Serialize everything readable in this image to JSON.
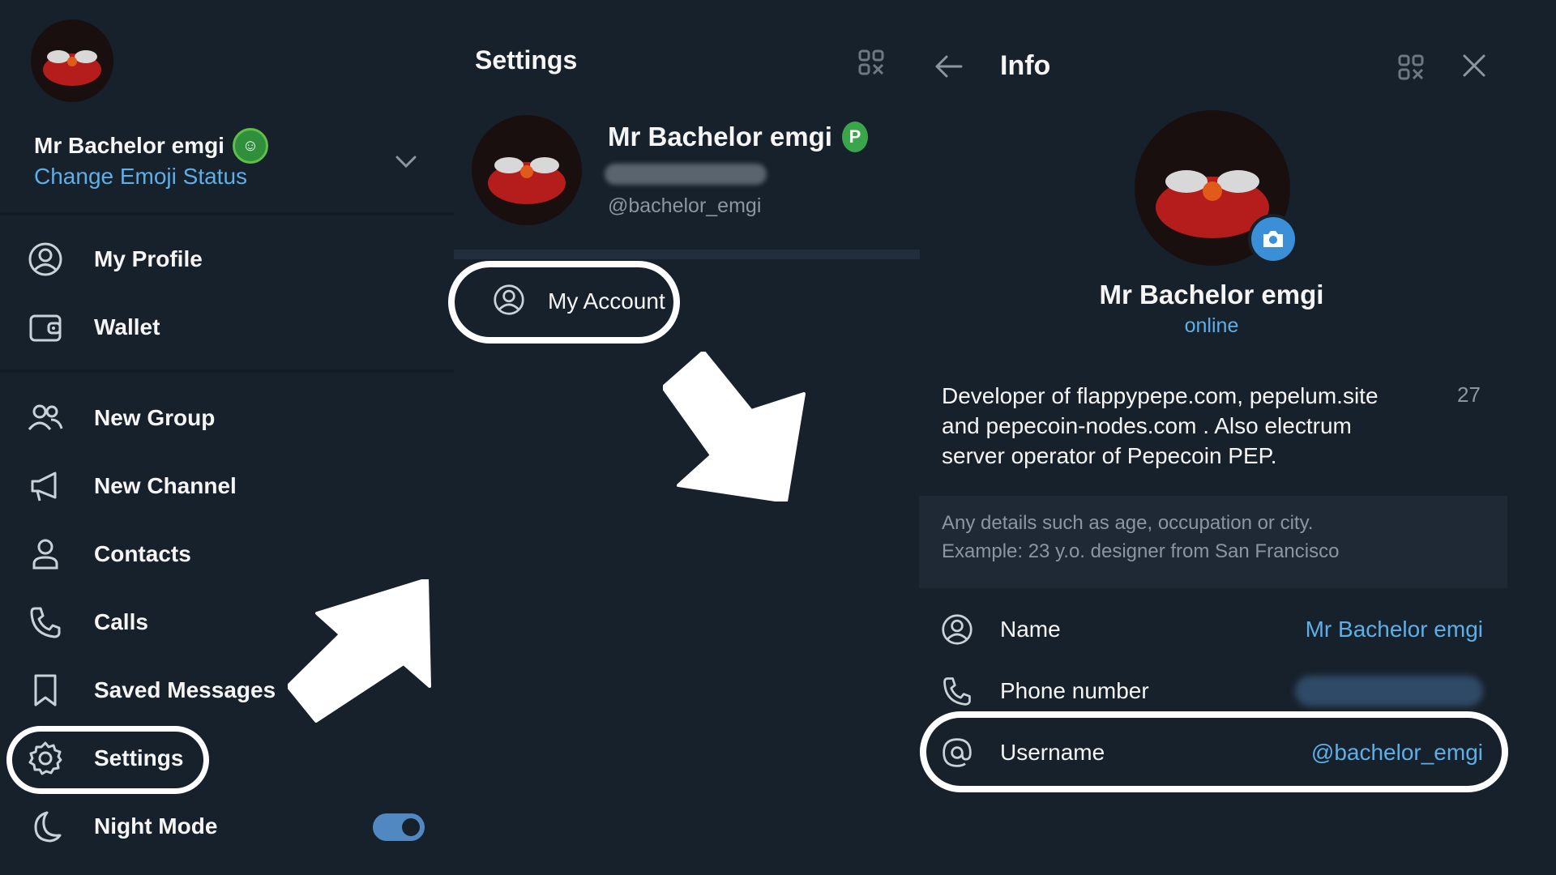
{
  "sidebar": {
    "user_name": "Mr Bachelor emgi",
    "status_link": "Change Emoji Status",
    "menu": [
      {
        "label": "My Profile",
        "icon": "profile-icon"
      },
      {
        "label": "Wallet",
        "icon": "wallet-icon"
      },
      {
        "label": "New Group",
        "icon": "group-icon"
      },
      {
        "label": "New Channel",
        "icon": "megaphone-icon"
      },
      {
        "label": "Contacts",
        "icon": "contact-icon"
      },
      {
        "label": "Calls",
        "icon": "phone-icon"
      },
      {
        "label": "Saved Messages",
        "icon": "bookmark-icon"
      },
      {
        "label": "Settings",
        "icon": "gear-icon"
      },
      {
        "label": "Night Mode",
        "icon": "moon-icon"
      }
    ],
    "night_mode_on": true
  },
  "settings": {
    "title": "Settings",
    "name": "Mr Bachelor emgi",
    "badge": "P",
    "username": "@bachelor_emgi",
    "items": [
      {
        "label": "My Account",
        "icon": "account-icon"
      }
    ]
  },
  "info": {
    "title": "Info",
    "name": "Mr Bachelor emgi",
    "status": "online",
    "bio": "Developer of flappypepe.com, pepelum.site and pepecoin-nodes.com . Also electrum server operator of Pepecoin PEP.",
    "bio_count": "27",
    "hint_line1": "Any details such as age, occupation or city.",
    "hint_line2": "Example: 23 y.o. designer from San Francisco",
    "rows": {
      "name": {
        "label": "Name",
        "value": "Mr Bachelor emgi"
      },
      "phone": {
        "label": "Phone number"
      },
      "username": {
        "label": "Username",
        "value": "@bachelor_emgi"
      }
    }
  },
  "colors": {
    "background": "#17212b",
    "accent": "#5eaee8",
    "toggle": "#5288c1"
  }
}
